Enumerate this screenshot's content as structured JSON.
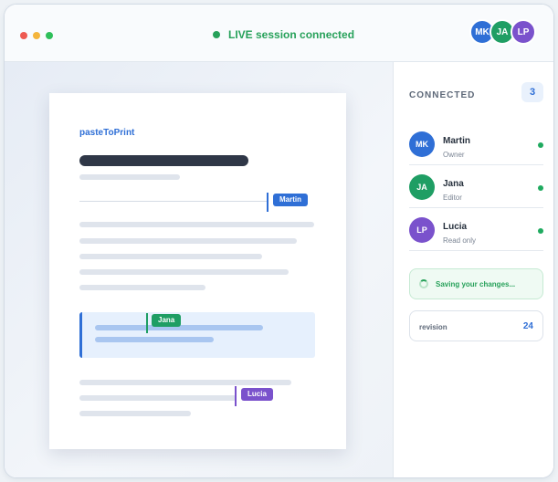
{
  "titlebar": {
    "window_controls": [
      {
        "name": "close",
        "color": "#ee5a52"
      },
      {
        "name": "minimize",
        "color": "#f4b53c"
      },
      {
        "name": "maximize",
        "color": "#2fbf5a"
      }
    ],
    "status_text": "LIVE session connected",
    "status_color": "#27a15a",
    "avatars": [
      {
        "initials": "MK",
        "color": "#2f6fd6"
      },
      {
        "initials": "JA",
        "color": "#1f9e64"
      },
      {
        "initials": "LP",
        "color": "#7a52cc"
      }
    ]
  },
  "document": {
    "brand": "pasteToPrint",
    "brand_color": "#2f6fd6",
    "cursors": [
      {
        "label": "Martin",
        "color": "#2f6fd6"
      },
      {
        "label": "Jana",
        "color": "#1f9e64"
      },
      {
        "label": "Lucia",
        "color": "#7a52cc"
      }
    ]
  },
  "sidebar": {
    "title": "CONNECTED",
    "count": "3",
    "users": [
      {
        "initials": "MK",
        "name": "Martin",
        "role": "Owner",
        "color": "#2f6fd6",
        "online_color": "#1faa5f"
      },
      {
        "initials": "JA",
        "name": "Jana",
        "role": "Editor",
        "color": "#1f9e64",
        "online_color": "#1faa5f"
      },
      {
        "initials": "LP",
        "name": "Lucia",
        "role": "Read only",
        "color": "#7a52cc",
        "online_color": "#1faa5f"
      }
    ],
    "saving_text": "Saving your changes...",
    "revision_label": "revision",
    "revision_value": "24"
  }
}
